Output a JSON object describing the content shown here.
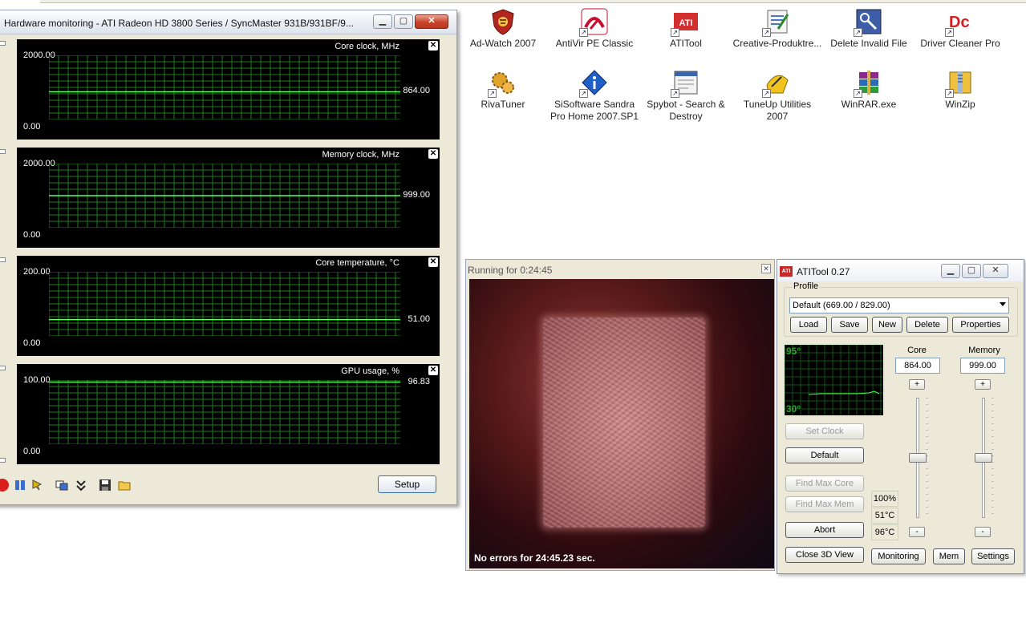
{
  "desktop_icons": [
    {
      "label": "Ad-Watch 2007",
      "icon": "ad-watch-shield-icon"
    },
    {
      "label": "AntiVir PE Classic",
      "icon": "antivir-umbrella-icon"
    },
    {
      "label": "ATITool",
      "icon": "atitool-icon"
    },
    {
      "label": "Creative-Produktre...",
      "icon": "creative-document-icon"
    },
    {
      "label": "Delete Invalid File",
      "icon": "delete-file-icon"
    },
    {
      "label": "Driver Cleaner Pro",
      "icon": "driver-cleaner-icon"
    },
    {
      "label": "RivaTuner",
      "icon": "rivatuner-gears-icon"
    },
    {
      "label": "SiSoftware Sandra Pro Home 2007.SP1",
      "icon": "sandra-icon"
    },
    {
      "label": "Spybot - Search & Destroy",
      "icon": "spybot-icon"
    },
    {
      "label": "TuneUp Utilities 2007",
      "icon": "tuneup-icon"
    },
    {
      "label": "WinRAR.exe",
      "icon": "winrar-books-icon"
    },
    {
      "label": "WinZip",
      "icon": "winzip-icon"
    }
  ],
  "hw_monitor": {
    "title": "Hardware monitoring - ATI Radeon HD 3800 Series / SyncMaster 931B/931BF/9...",
    "graphs": [
      {
        "caption": "Core clock, MHz",
        "max": "2000.00",
        "min": "0.00",
        "current": "864.00",
        "level": 0.432
      },
      {
        "caption": "Memory clock, MHz",
        "max": "2000.00",
        "min": "0.00",
        "current": "999.00",
        "level": 0.4995
      },
      {
        "caption": "Core temperature, °C",
        "max": "200.00",
        "min": "0.00",
        "current": "51.00",
        "level": 0.255
      },
      {
        "caption": "GPU usage, %",
        "max": "100.00",
        "min": "0.00",
        "current": "96.83",
        "level": 0.9683
      }
    ],
    "setup_label": "Setup"
  },
  "view3d": {
    "title": "Running for 0:24:45",
    "status": "No errors for 24:45.23 sec."
  },
  "atitool": {
    "title": "ATITool 0.27",
    "profile_legend": "Profile",
    "profile_value": "Default (669.00 / 829.00)",
    "buttons": {
      "load": "Load",
      "save": "Save",
      "new": "New",
      "delete": "Delete",
      "properties": "Properties",
      "set_clock": "Set Clock",
      "default": "Default",
      "find_max_core": "Find Max Core",
      "find_max_mem": "Find Max Mem",
      "abort": "Abort",
      "close_3d": "Close 3D View",
      "monitoring": "Monitoring",
      "mem": "Mem",
      "settings": "Settings"
    },
    "temp_graph": {
      "hi": "95°",
      "lo": "30°"
    },
    "core_label": "Core",
    "core_value": "864.00",
    "memory_label": "Memory",
    "memory_value": "999.00",
    "plus": "+",
    "minus": "-",
    "stats": {
      "usage": "100%",
      "temp1": "51°C",
      "temp2": "96°C"
    }
  }
}
